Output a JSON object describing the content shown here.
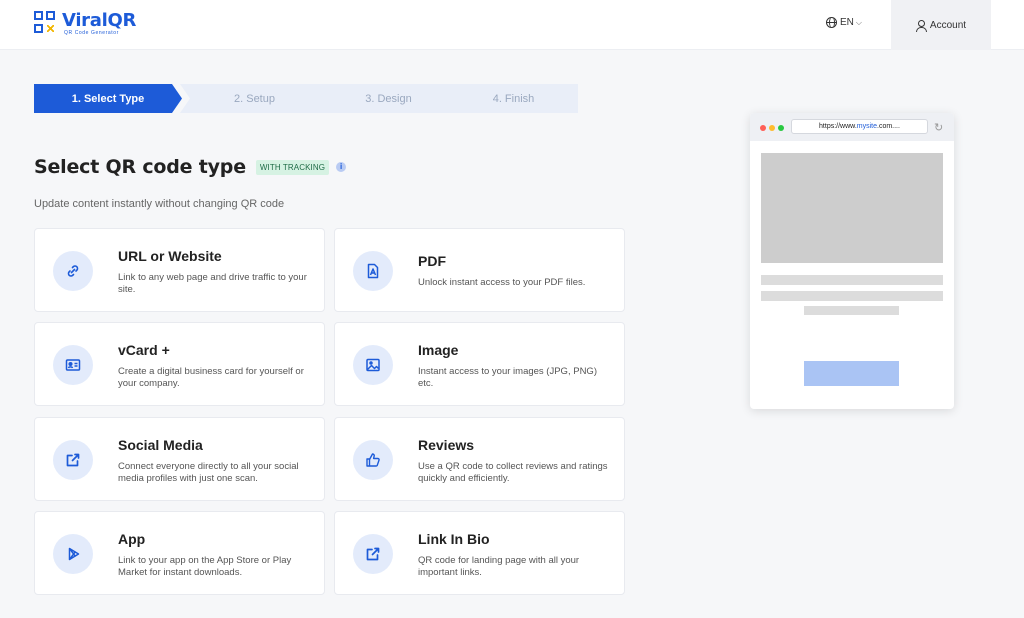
{
  "header": {
    "logo_name": "ViralQR",
    "logo_tagline": "QR Code Generator",
    "language": "EN",
    "account": "Account"
  },
  "steps": [
    {
      "label": "1. Select Type",
      "active": true
    },
    {
      "label": "2. Setup",
      "active": false
    },
    {
      "label": "3. Design",
      "active": false
    },
    {
      "label": "4. Finish",
      "active": false
    }
  ],
  "main": {
    "title": "Select QR code type",
    "badge": "WITH TRACKING",
    "info": "i",
    "subtitle": "Update content instantly without changing QR code"
  },
  "types": [
    {
      "title": "URL or Website",
      "desc": "Link to any web page and drive traffic to your site.",
      "icon": "link-icon"
    },
    {
      "title": "PDF",
      "desc": "Unlock instant access to your PDF files.",
      "icon": "pdf-icon"
    },
    {
      "title": "vCard +",
      "desc": "Create a digital business card for yourself or your company.",
      "icon": "contact-card-icon"
    },
    {
      "title": "Image",
      "desc": "Instant access to your images (JPG, PNG) etc.",
      "icon": "image-icon"
    },
    {
      "title": "Social Media",
      "desc": "Connect everyone directly to all your social media profiles with just one scan.",
      "icon": "share-icon"
    },
    {
      "title": "Reviews",
      "desc": "Use a QR code to collect reviews and ratings quickly and efficiently.",
      "icon": "thumbs-up-icon"
    },
    {
      "title": "App",
      "desc": "Link to your app on the App Store or Play Market for instant downloads.",
      "icon": "play-icon"
    },
    {
      "title": "Link In Bio",
      "desc": "QR code for landing page with all your important links.",
      "icon": "external-link-icon"
    }
  ],
  "preview": {
    "url_prefix": "https://www.",
    "url_domain": "mysite",
    "url_suffix": ".com...."
  },
  "colors": {
    "accent": "#1d5bd8",
    "badge_bg": "#d6f2e3",
    "step_inactive": "#e9eef8",
    "dot_red": "#ff5f57",
    "dot_yellow": "#febc2e",
    "dot_green": "#28c840"
  }
}
